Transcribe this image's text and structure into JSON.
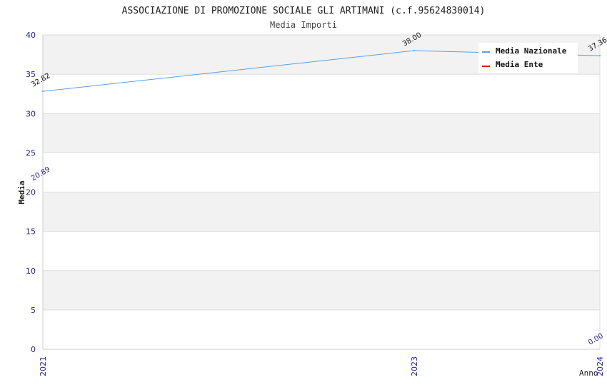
{
  "chart_data": {
    "type": "line",
    "title": "ASSOCIAZIONE DI PROMOZIONE SOCIALE GLI ARTIMANI (c.f.95624830014)",
    "subtitle": "Media Importi",
    "xlabel": "Anno",
    "ylabel": "Media",
    "x": [
      "2021",
      "2023",
      "2024"
    ],
    "ylim": [
      0,
      40
    ],
    "yticks": [
      "0",
      "5",
      "10",
      "15",
      "20",
      "25",
      "30",
      "35",
      "40"
    ],
    "grid": "horizontal bands",
    "legend_position": "top-right",
    "series": [
      {
        "name": "Media Nazionale",
        "color": "#5aa0e6",
        "values": [
          32.82,
          38.0,
          37.36
        ],
        "labels": [
          "32.82",
          "38.00",
          "37.36"
        ]
      },
      {
        "name": "Media Ente",
        "color": "#e00000",
        "values": [
          20.89,
          0.0
        ],
        "value_x": [
          "2021",
          "2024"
        ],
        "labels": [
          "20.89",
          "0.00"
        ]
      }
    ]
  }
}
